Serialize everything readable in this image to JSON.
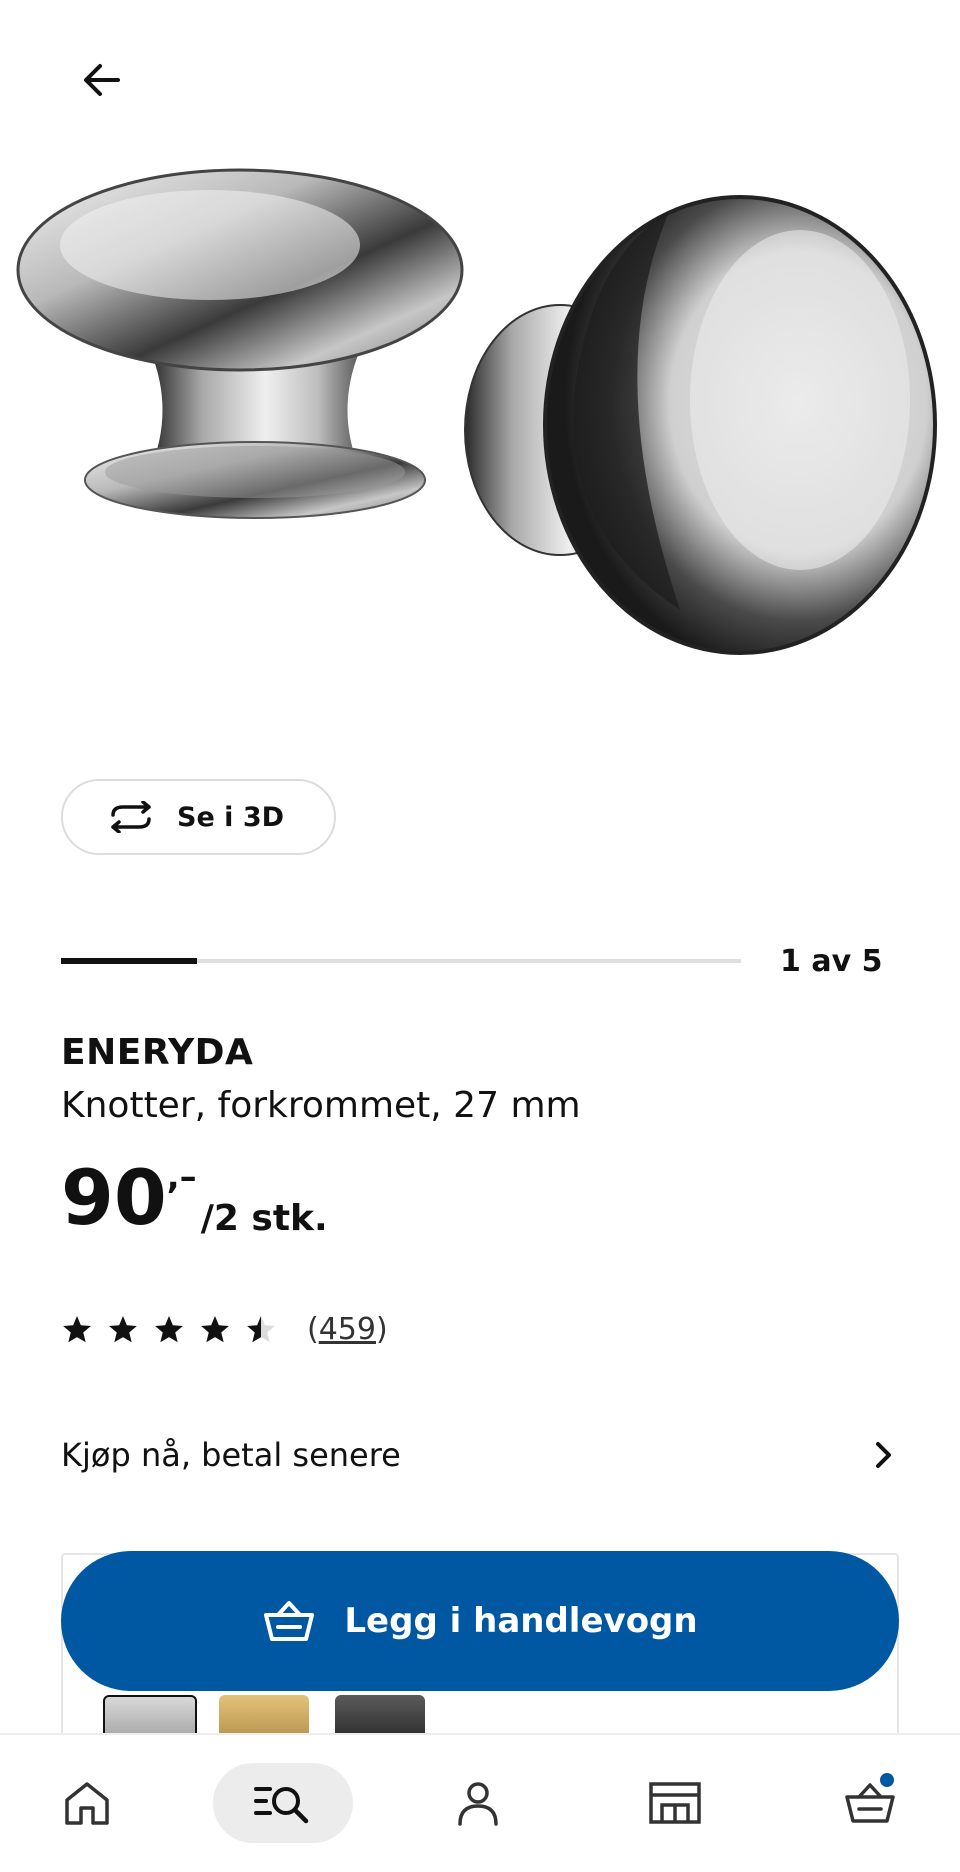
{
  "header": {
    "back_icon": "arrow-left-icon"
  },
  "product_image": {
    "description_icon": "cabinet-knob-image"
  },
  "view_3d": {
    "label": "Se i 3D",
    "icon": "rotate-3d-icon"
  },
  "gallery": {
    "position_text": "1 av 5",
    "progress": 0.2
  },
  "product": {
    "name": "ENERYDA",
    "description": "Knotter, forkrommet, 27 mm",
    "price_main": "90",
    "price_decimals": ",–",
    "price_unit": "/2 stk."
  },
  "rating": {
    "stars": 4.5,
    "count_open": "(",
    "count": "459",
    "count_close": ")"
  },
  "payment": {
    "label": "Kjøp nå, betal senere",
    "icon": "chevron-right-icon"
  },
  "cart_button": {
    "label": "Legg i handlevogn",
    "icon": "basket-icon",
    "color": "#0058a3"
  },
  "nav": {
    "items": [
      "home-icon",
      "search-list-icon",
      "profile-icon",
      "store-icon",
      "cart-icon"
    ],
    "active": "search-list-icon",
    "cart_badge_color": "#0058a3"
  }
}
